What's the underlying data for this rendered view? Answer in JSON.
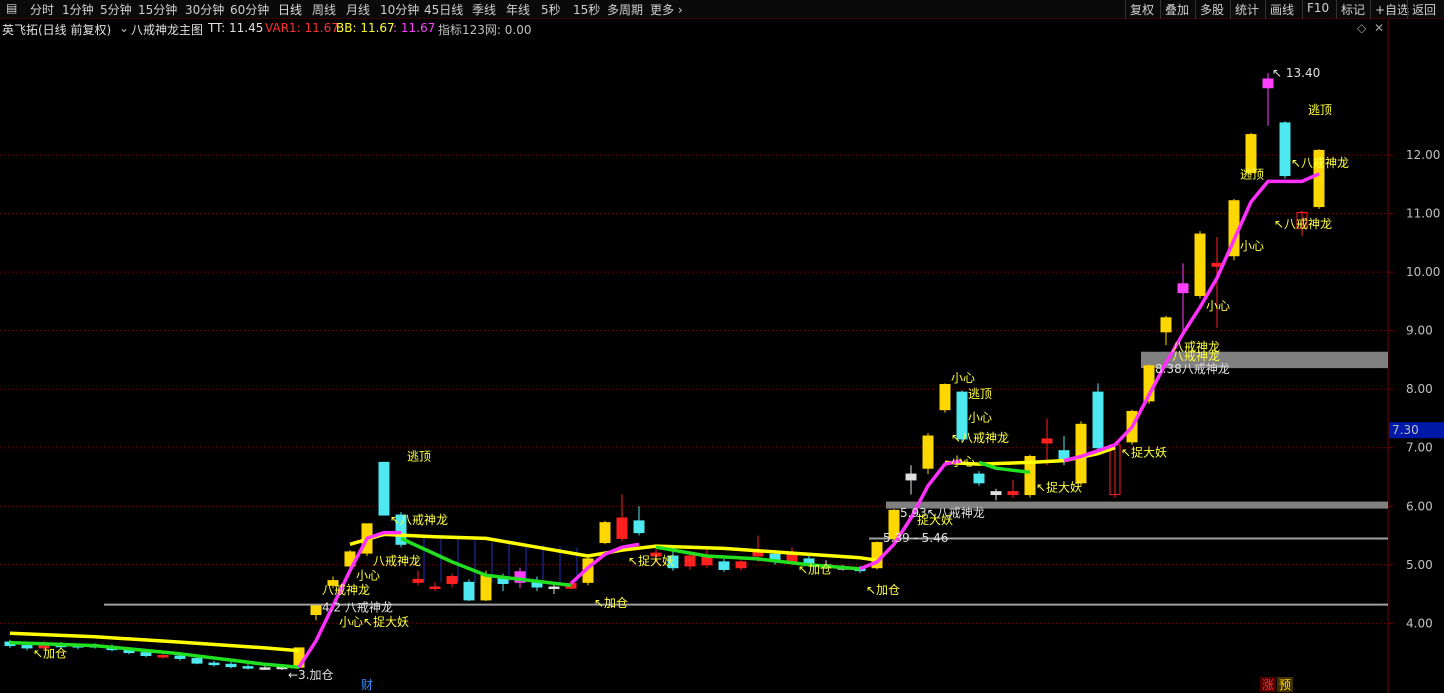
{
  "toolbar": {
    "periods": [
      "分时",
      "1分钟",
      "5分钟",
      "15分钟",
      "30分钟",
      "60分钟",
      "日线",
      "周线",
      "月线",
      "10分钟",
      "45日线",
      "季线",
      "年线",
      "5秒",
      "15秒",
      "多周期",
      "更多 ›"
    ],
    "active_period": "日线",
    "right_items": [
      "复权",
      "叠加",
      "多股",
      "统计",
      "画线",
      "F10",
      "标记",
      "+自选",
      "返回"
    ]
  },
  "indicator": {
    "stock": "英飞拓(日线 前复权)",
    "name": "八戒神龙主图",
    "tt": "TT: 11.45",
    "var1": "VAR1: 11.67",
    "bb": "BB: 11.67",
    "extra": ": 11.67",
    "zb": "指标123网: 0.00"
  },
  "colors": {
    "up": "#ffd700",
    "down": "#4de8f0",
    "pink": "#ff40ff",
    "red": "#ff2020",
    "yellow_line": "#ffff00",
    "green_line": "#20e020",
    "magenta_line": "#ff30ff",
    "grid": "#800000",
    "price_tag_bg": "#0018a8"
  },
  "chart_data": {
    "type": "candlestick",
    "ylim": [
      3.1,
      14.0
    ],
    "y_ticks": [
      4.0,
      5.0,
      6.0,
      7.0,
      8.0,
      9.0,
      10.0,
      11.0,
      12.0
    ],
    "current_price_tag": "7.30",
    "max_label": "13.40",
    "candles": [
      {
        "x": 0,
        "o": 3.68,
        "c": 3.62,
        "h": 3.72,
        "l": 3.58,
        "k": "down"
      },
      {
        "x": 1,
        "o": 3.62,
        "c": 3.58,
        "h": 3.66,
        "l": 3.54,
        "k": "down"
      },
      {
        "x": 2,
        "o": 3.58,
        "c": 3.65,
        "h": 3.7,
        "l": 3.55,
        "k": "red"
      },
      {
        "x": 3,
        "o": 3.64,
        "c": 3.6,
        "h": 3.68,
        "l": 3.57,
        "k": "down"
      },
      {
        "x": 4,
        "o": 3.6,
        "c": 3.62,
        "h": 3.65,
        "l": 3.56,
        "k": "down"
      },
      {
        "x": 5,
        "o": 3.62,
        "c": 3.6,
        "h": 3.66,
        "l": 3.57,
        "k": "down"
      },
      {
        "x": 6,
        "o": 3.6,
        "c": 3.55,
        "h": 3.64,
        "l": 3.52,
        "k": "down"
      },
      {
        "x": 7,
        "o": 3.55,
        "c": 3.5,
        "h": 3.58,
        "l": 3.47,
        "k": "down"
      },
      {
        "x": 8,
        "o": 3.5,
        "c": 3.45,
        "h": 3.54,
        "l": 3.42,
        "k": "down"
      },
      {
        "x": 9,
        "o": 3.45,
        "c": 3.44,
        "h": 3.5,
        "l": 3.4,
        "k": "red"
      },
      {
        "x": 10,
        "o": 3.44,
        "c": 3.4,
        "h": 3.47,
        "l": 3.36,
        "k": "down"
      },
      {
        "x": 11,
        "o": 3.4,
        "c": 3.32,
        "h": 3.43,
        "l": 3.3,
        "k": "down"
      },
      {
        "x": 12,
        "o": 3.32,
        "c": 3.3,
        "h": 3.36,
        "l": 3.26,
        "k": "down"
      },
      {
        "x": 13,
        "o": 3.3,
        "c": 3.26,
        "h": 3.34,
        "l": 3.23,
        "k": "down"
      },
      {
        "x": 14,
        "o": 3.26,
        "c": 3.24,
        "h": 3.3,
        "l": 3.21,
        "k": "down"
      },
      {
        "x": 15,
        "o": 3.24,
        "c": 3.24,
        "h": 3.28,
        "l": 3.2,
        "k": "cross"
      },
      {
        "x": 16,
        "o": 3.24,
        "c": 3.25,
        "h": 3.28,
        "l": 3.2,
        "k": "cross"
      },
      {
        "x": 17,
        "o": 3.25,
        "c": 3.58,
        "h": 3.58,
        "l": 3.24,
        "k": "up"
      },
      {
        "x": 18,
        "o": 4.15,
        "c": 4.3,
        "h": 4.3,
        "l": 4.05,
        "k": "up"
      },
      {
        "x": 19,
        "o": 4.65,
        "c": 4.73,
        "h": 4.8,
        "l": 4.6,
        "k": "up"
      },
      {
        "x": 20,
        "o": 4.98,
        "c": 5.22,
        "h": 5.25,
        "l": 4.95,
        "k": "up"
      },
      {
        "x": 21,
        "o": 5.2,
        "c": 5.7,
        "h": 5.7,
        "l": 5.15,
        "k": "up"
      },
      {
        "x": 22,
        "o": 6.75,
        "c": 5.85,
        "h": 6.75,
        "l": 5.85,
        "k": "down"
      },
      {
        "x": 23,
        "o": 5.85,
        "c": 5.35,
        "h": 5.9,
        "l": 5.3,
        "k": "down"
      },
      {
        "x": 24,
        "o": 4.7,
        "c": 4.75,
        "h": 4.9,
        "l": 4.65,
        "k": "red"
      },
      {
        "x": 25,
        "o": 4.6,
        "c": 4.62,
        "h": 4.7,
        "l": 4.55,
        "k": "red"
      },
      {
        "x": 26,
        "o": 4.8,
        "c": 4.68,
        "h": 4.85,
        "l": 4.62,
        "k": "red"
      },
      {
        "x": 27,
        "o": 4.7,
        "c": 4.4,
        "h": 4.75,
        "l": 4.38,
        "k": "down"
      },
      {
        "x": 28,
        "o": 4.4,
        "c": 4.82,
        "h": 4.9,
        "l": 4.38,
        "k": "up"
      },
      {
        "x": 29,
        "o": 4.8,
        "c": 4.68,
        "h": 4.85,
        "l": 4.55,
        "k": "down"
      },
      {
        "x": 30,
        "o": 4.88,
        "c": 4.7,
        "h": 4.95,
        "l": 4.6,
        "k": "pink"
      },
      {
        "x": 31,
        "o": 4.72,
        "c": 4.62,
        "h": 4.8,
        "l": 4.55,
        "k": "down"
      },
      {
        "x": 32,
        "o": 4.62,
        "c": 4.6,
        "h": 4.66,
        "l": 4.5,
        "k": "cross"
      },
      {
        "x": 33,
        "o": 4.6,
        "c": 4.68,
        "h": 4.72,
        "l": 4.58,
        "k": "red"
      },
      {
        "x": 34,
        "o": 4.7,
        "c": 5.1,
        "h": 5.12,
        "l": 4.65,
        "k": "up"
      },
      {
        "x": 35,
        "o": 5.38,
        "c": 5.72,
        "h": 5.75,
        "l": 5.35,
        "k": "up"
      },
      {
        "x": 36,
        "o": 5.45,
        "c": 5.8,
        "h": 6.2,
        "l": 5.4,
        "k": "red"
      },
      {
        "x": 37,
        "o": 5.75,
        "c": 5.55,
        "h": 6.0,
        "l": 5.5,
        "k": "down"
      },
      {
        "x": 38,
        "o": 5.2,
        "c": 5.15,
        "h": 5.3,
        "l": 5.05,
        "k": "red"
      },
      {
        "x": 39,
        "o": 5.15,
        "c": 4.95,
        "h": 5.3,
        "l": 4.9,
        "k": "down"
      },
      {
        "x": 40,
        "o": 4.98,
        "c": 5.15,
        "h": 5.2,
        "l": 4.92,
        "k": "red"
      },
      {
        "x": 41,
        "o": 5.15,
        "c": 5.0,
        "h": 5.3,
        "l": 4.95,
        "k": "red"
      },
      {
        "x": 42,
        "o": 5.05,
        "c": 4.92,
        "h": 5.1,
        "l": 4.88,
        "k": "down"
      },
      {
        "x": 43,
        "o": 4.95,
        "c": 5.05,
        "h": 5.1,
        "l": 4.9,
        "k": "red"
      },
      {
        "x": 44,
        "o": 5.15,
        "c": 5.25,
        "h": 5.5,
        "l": 5.05,
        "k": "red"
      },
      {
        "x": 45,
        "o": 5.18,
        "c": 5.08,
        "h": 5.25,
        "l": 5.0,
        "k": "down"
      },
      {
        "x": 46,
        "o": 5.05,
        "c": 5.18,
        "h": 5.3,
        "l": 5.0,
        "k": "red"
      },
      {
        "x": 47,
        "o": 5.1,
        "c": 5.03,
        "h": 5.2,
        "l": 4.98,
        "k": "down"
      },
      {
        "x": 48,
        "o": 5.0,
        "c": 4.98,
        "h": 5.08,
        "l": 4.93,
        "k": "cross"
      },
      {
        "x": 49,
        "o": 4.95,
        "c": 4.93,
        "h": 5.0,
        "l": 4.9,
        "k": "cross"
      },
      {
        "x": 50,
        "o": 4.93,
        "c": 4.9,
        "h": 4.98,
        "l": 4.86,
        "k": "down"
      },
      {
        "x": 51,
        "o": 4.95,
        "c": 5.38,
        "h": 5.4,
        "l": 4.92,
        "k": "up"
      },
      {
        "x": 52,
        "o": 5.45,
        "c": 5.93,
        "h": 5.95,
        "l": 5.4,
        "k": "up"
      },
      {
        "x": 53,
        "o": 6.45,
        "c": 6.55,
        "h": 6.7,
        "l": 6.2,
        "k": "cross"
      },
      {
        "x": 54,
        "o": 6.65,
        "c": 7.2,
        "h": 7.25,
        "l": 6.55,
        "k": "up"
      },
      {
        "x": 55,
        "o": 7.65,
        "c": 8.08,
        "h": 8.1,
        "l": 7.6,
        "k": "up"
      },
      {
        "x": 56,
        "o": 7.95,
        "c": 7.15,
        "h": 7.98,
        "l": 7.1,
        "k": "down"
      },
      {
        "x": 57,
        "o": 6.55,
        "c": 6.4,
        "h": 6.6,
        "l": 6.35,
        "k": "down"
      },
      {
        "x": 58,
        "o": 6.25,
        "c": 6.2,
        "h": 6.3,
        "l": 6.1,
        "k": "cross"
      },
      {
        "x": 59,
        "o": 6.2,
        "c": 6.25,
        "h": 6.45,
        "l": 6.15,
        "k": "red"
      },
      {
        "x": 60,
        "o": 6.2,
        "c": 6.85,
        "h": 6.88,
        "l": 6.15,
        "k": "up"
      },
      {
        "x": 61,
        "o": 7.08,
        "c": 7.15,
        "h": 7.5,
        "l": 6.7,
        "k": "red"
      },
      {
        "x": 62,
        "o": 6.95,
        "c": 6.78,
        "h": 7.2,
        "l": 6.7,
        "k": "down"
      },
      {
        "x": 63,
        "o": 6.4,
        "c": 7.4,
        "h": 7.45,
        "l": 6.35,
        "k": "up"
      },
      {
        "x": 64,
        "o": 7.95,
        "c": 7.0,
        "h": 8.1,
        "l": 6.9,
        "k": "down"
      },
      {
        "x": 65,
        "o": 6.2,
        "c": 7.05,
        "h": 7.1,
        "l": 6.15,
        "k": "red_hollow"
      },
      {
        "x": 66,
        "o": 7.1,
        "c": 7.62,
        "h": 7.65,
        "l": 7.05,
        "k": "up"
      },
      {
        "x": 67,
        "o": 7.8,
        "c": 8.4,
        "h": 8.42,
        "l": 7.75,
        "k": "up"
      },
      {
        "x": 68,
        "o": 8.98,
        "c": 9.22,
        "h": 9.25,
        "l": 8.75,
        "k": "up"
      },
      {
        "x": 69,
        "o": 9.8,
        "c": 9.65,
        "h": 10.15,
        "l": 9.0,
        "k": "pink"
      },
      {
        "x": 70,
        "o": 9.6,
        "c": 10.65,
        "h": 10.7,
        "l": 9.55,
        "k": "up"
      },
      {
        "x": 71,
        "o": 10.15,
        "c": 10.1,
        "h": 10.6,
        "l": 9.05,
        "k": "red"
      },
      {
        "x": 72,
        "o": 10.28,
        "c": 11.22,
        "h": 11.25,
        "l": 10.2,
        "k": "up"
      },
      {
        "x": 73,
        "o": 11.7,
        "c": 12.35,
        "h": 12.38,
        "l": 11.65,
        "k": "up"
      },
      {
        "x": 74,
        "o": 13.3,
        "c": 13.15,
        "h": 13.4,
        "l": 12.5,
        "k": "pink"
      },
      {
        "x": 75,
        "o": 12.55,
        "c": 11.65,
        "h": 12.58,
        "l": 11.6,
        "k": "down"
      },
      {
        "x": 76,
        "o": 11.02,
        "c": 10.75,
        "h": 11.05,
        "l": 10.62,
        "k": "red_hollow"
      },
      {
        "x": 77,
        "o": 11.12,
        "c": 12.08,
        "h": 12.1,
        "l": 11.08,
        "k": "up"
      }
    ],
    "ma_line": [
      [
        0,
        3.83
      ],
      [
        5,
        3.77
      ],
      [
        10,
        3.68
      ],
      [
        15,
        3.58
      ],
      [
        17,
        3.53
      ],
      [
        20,
        5.35
      ],
      [
        22,
        5.52
      ],
      [
        25,
        5.48
      ],
      [
        28,
        5.45
      ],
      [
        31,
        5.3
      ],
      [
        34,
        5.15
      ],
      [
        36,
        5.25
      ],
      [
        38,
        5.32
      ],
      [
        42,
        5.28
      ],
      [
        46,
        5.2
      ],
      [
        50,
        5.12
      ],
      [
        51,
        5.08
      ],
      [
        55,
        6.75
      ],
      [
        57,
        6.72
      ],
      [
        60,
        6.75
      ],
      [
        62,
        6.78
      ],
      [
        64,
        6.9
      ],
      [
        65,
        7.0
      ]
    ],
    "green_segments": [
      [
        [
          0,
          3.67
        ],
        [
          5,
          3.62
        ],
        [
          10,
          3.48
        ],
        [
          15,
          3.3
        ],
        [
          17,
          3.25
        ]
      ],
      [
        [
          23,
          5.45
        ],
        [
          26,
          5.05
        ],
        [
          28,
          4.82
        ],
        [
          31,
          4.72
        ],
        [
          33,
          4.65
        ]
      ],
      [
        [
          38,
          5.3
        ],
        [
          41,
          5.15
        ],
        [
          44,
          5.1
        ],
        [
          47,
          5.0
        ],
        [
          50,
          4.93
        ]
      ],
      [
        [
          57,
          6.75
        ],
        [
          58,
          6.65
        ],
        [
          60,
          6.58
        ]
      ]
    ],
    "magenta_line": [
      [
        17,
        3.25
      ],
      [
        18,
        3.7
      ],
      [
        19,
        4.3
      ],
      [
        20,
        4.9
      ],
      [
        21,
        5.45
      ],
      [
        22,
        5.55
      ],
      [
        23,
        5.55
      ],
      [
        33,
        4.68
      ],
      [
        34,
        4.95
      ],
      [
        35,
        5.18
      ],
      [
        36,
        5.3
      ],
      [
        37,
        5.35
      ],
      [
        50,
        4.93
      ],
      [
        51,
        5.05
      ],
      [
        52,
        5.35
      ],
      [
        53,
        5.8
      ],
      [
        54,
        6.35
      ],
      [
        55,
        6.72
      ],
      [
        56,
        6.78
      ],
      [
        62,
        6.78
      ],
      [
        63,
        6.85
      ],
      [
        64,
        6.95
      ],
      [
        65,
        7.05
      ],
      [
        66,
        7.35
      ],
      [
        67,
        7.9
      ],
      [
        68,
        8.45
      ],
      [
        69,
        8.95
      ],
      [
        70,
        9.4
      ],
      [
        71,
        9.9
      ],
      [
        72,
        10.55
      ],
      [
        73,
        11.2
      ],
      [
        74,
        11.55
      ],
      [
        75,
        11.55
      ],
      [
        76,
        11.55
      ],
      [
        77,
        11.68
      ]
    ],
    "h_lines": [
      {
        "y": 4.32,
        "x0": 6,
        "x1": 80
      },
      {
        "y": 5.45,
        "x0": 51,
        "x1": 80
      },
      {
        "y": 6.02,
        "x0": 52,
        "x1": 80,
        "band": true
      },
      {
        "y": 8.5,
        "x0": 67,
        "x1": 80,
        "band": true,
        "w": 0.28
      }
    ],
    "annotations": [
      {
        "x": 1,
        "y": 3.42,
        "t": "↖加仓",
        "c": "sig"
      },
      {
        "x": 16,
        "y": 3.05,
        "t": "←3.加仓",
        "c": "sig-w"
      },
      {
        "x": 18,
        "y": 4.5,
        "t": "八戒神龙",
        "c": "sig"
      },
      {
        "x": 18,
        "y": 4.2,
        "t": "4.2 八戒神龙",
        "c": "sig-w"
      },
      {
        "x": 19,
        "y": 3.95,
        "t": "小心↖捉大妖",
        "c": "sig"
      },
      {
        "x": 20,
        "y": 4.75,
        "t": "小心",
        "c": "sig"
      },
      {
        "x": 21,
        "y": 5.0,
        "t": "八戒神龙",
        "c": "sig"
      },
      {
        "x": 22,
        "y": 5.7,
        "t": "↖八戒神龙",
        "c": "sig"
      },
      {
        "x": 23,
        "y": 6.78,
        "t": "逃顶",
        "c": "sig"
      },
      {
        "x": 34,
        "y": 4.28,
        "t": "↖加仓",
        "c": "sig"
      },
      {
        "x": 36,
        "y": 5.0,
        "t": "↖捉大妖",
        "c": "sig"
      },
      {
        "x": 46,
        "y": 4.85,
        "t": "↖加仓",
        "c": "sig"
      },
      {
        "x": 50,
        "y": 4.5,
        "t": "↖加仓",
        "c": "sig"
      },
      {
        "x": 51,
        "y": 5.39,
        "t": "5.39 - 5.46",
        "c": "sig-w"
      },
      {
        "x": 52,
        "y": 5.82,
        "t": "5.93↖八戒神龙",
        "c": "sig-w"
      },
      {
        "x": 53,
        "y": 5.7,
        "t": "捉大妖",
        "c": "sig"
      },
      {
        "x": 55,
        "y": 6.7,
        "t": "小心",
        "c": "sig"
      },
      {
        "x": 55,
        "y": 7.1,
        "t": "↖八戒神龙",
        "c": "sig"
      },
      {
        "x": 56,
        "y": 7.45,
        "t": "小心",
        "c": "sig"
      },
      {
        "x": 56,
        "y": 7.85,
        "t": "逃顶",
        "c": "sig"
      },
      {
        "x": 55,
        "y": 8.12,
        "t": "小心",
        "c": "sig"
      },
      {
        "x": 60,
        "y": 6.25,
        "t": "↖捉大妖",
        "c": "sig"
      },
      {
        "x": 65,
        "y": 6.85,
        "t": "↖捉大妖",
        "c": "sig"
      },
      {
        "x": 67,
        "y": 8.28,
        "t": "8.38八戒神龙",
        "c": "sig-w"
      },
      {
        "x": 68,
        "y": 8.5,
        "t": "八戒神龙",
        "c": "sig"
      },
      {
        "x": 68,
        "y": 8.65,
        "t": "八戒神龙",
        "c": "sig"
      },
      {
        "x": 70,
        "y": 9.35,
        "t": "小心",
        "c": "sig"
      },
      {
        "x": 72,
        "y": 10.38,
        "t": "小心",
        "c": "sig"
      },
      {
        "x": 72,
        "y": 11.6,
        "t": "逃顶",
        "c": "sig"
      },
      {
        "x": 74,
        "y": 10.75,
        "t": "↖八戒神龙",
        "c": "sig"
      },
      {
        "x": 75,
        "y": 11.8,
        "t": "↖八戒神龙",
        "c": "sig"
      },
      {
        "x": 76,
        "y": 12.7,
        "t": "逃顶",
        "c": "sig"
      }
    ],
    "bottom_markers": [
      {
        "x": 21,
        "t": "财",
        "color": "#3090ff"
      },
      {
        "x": 74,
        "t": "涨",
        "color": "#ff3030",
        "bg": "#500000"
      },
      {
        "x": 75,
        "t": "预",
        "color": "#ffd700",
        "bg": "#403000"
      }
    ]
  }
}
